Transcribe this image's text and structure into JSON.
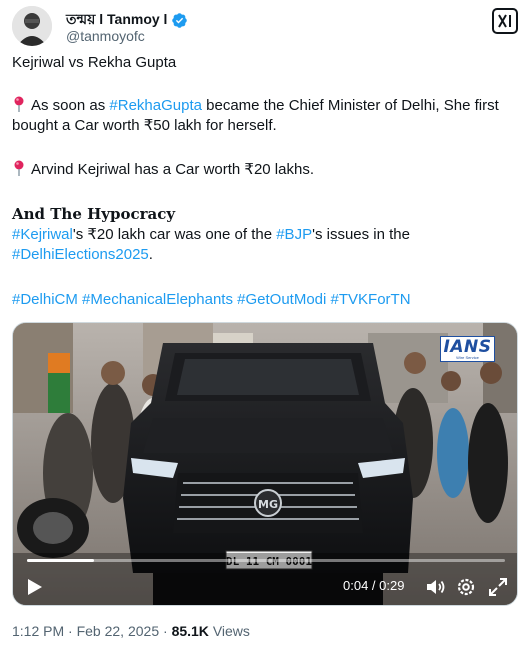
{
  "author": {
    "display_name": "তন্ময় l Tanmoy l",
    "handle": "@tanmoyofc"
  },
  "post": {
    "line1": "Kejriwal vs Rekha Gupta",
    "p2_a": "As soon as ",
    "p2_tag": "#RekhaGupta",
    "p2_b": " became the Chief Minister of Delhi, She first bought a Car worth ₹50 lakh for herself.",
    "p3": "Arvind Kejriwal has a Car worth ₹20 lakhs.",
    "heading": "And The Hypocracy",
    "p5_tag1": "#Kejriwal",
    "p5_a": "'s ₹20 lakh car was one of the ",
    "p5_tag2": "#BJP",
    "p5_b": "'s issues in the ",
    "p5_tag3": "#DelhiElections2025",
    "p5_c": ".",
    "hashtags": [
      "#DelhiCM",
      "#MechanicalElephants",
      "#GetOutModi",
      "#TVKForTN"
    ]
  },
  "video": {
    "watermark": "IANS",
    "watermark_sub": "Wire Service",
    "number_plate": "DL 11 CM 0001",
    "grille_badge": "MG",
    "current_time": "0:04",
    "duration": "0:29",
    "time_display": "0:04 / 0:29",
    "progress_fraction": 0.14
  },
  "meta": {
    "time": "1:12 PM",
    "date": "Feb 22, 2025",
    "views_count": "85.1K",
    "views_label": "Views",
    "separator": "·"
  },
  "colors": {
    "link": "#1d9bf0",
    "text": "#0f1419",
    "muted": "#536471",
    "verified": "#1d9bf0"
  }
}
